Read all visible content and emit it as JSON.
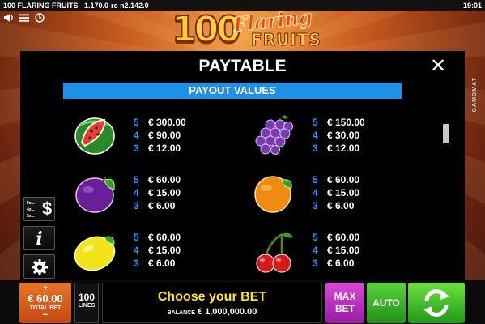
{
  "status_bar": {
    "title": "100 FLARING FRUITS",
    "version": "1.170.0-rc n2.142.0",
    "clock": "19:01"
  },
  "logo": {
    "number": "100",
    "word1": "Flaring",
    "word2": "FRUITS"
  },
  "brand": "GAMOMAT",
  "paytable": {
    "title": "PAYTABLE",
    "close_label": "✕",
    "section_title": "PAYOUT VALUES",
    "symbols": [
      {
        "icon": "watermelon-icon",
        "pays": [
          {
            "count": "5",
            "value": "€ 300.00"
          },
          {
            "count": "4",
            "value": "€ 90.00"
          },
          {
            "count": "3",
            "value": "€ 12.00"
          }
        ]
      },
      {
        "icon": "grapes-icon",
        "pays": [
          {
            "count": "5",
            "value": "€ 150.00"
          },
          {
            "count": "4",
            "value": "€ 30.00"
          },
          {
            "count": "3",
            "value": "€ 12.00"
          }
        ]
      },
      {
        "icon": "plum-icon",
        "pays": [
          {
            "count": "5",
            "value": "€ 60.00"
          },
          {
            "count": "4",
            "value": "€ 15.00"
          },
          {
            "count": "3",
            "value": "€ 6.00"
          }
        ]
      },
      {
        "icon": "orange-icon",
        "pays": [
          {
            "count": "5",
            "value": "€ 60.00"
          },
          {
            "count": "4",
            "value": "€ 15.00"
          },
          {
            "count": "3",
            "value": "€ 6.00"
          }
        ]
      },
      {
        "icon": "lemon-icon",
        "pays": [
          {
            "count": "5",
            "value": "€ 60.00"
          },
          {
            "count": "4",
            "value": "€ 15.00"
          },
          {
            "count": "3",
            "value": "€ 6.00"
          }
        ]
      },
      {
        "icon": "cherries-icon",
        "pays": [
          {
            "count": "5",
            "value": "€ 60.00"
          },
          {
            "count": "4",
            "value": "€ 15.00"
          },
          {
            "count": "3",
            "value": "€ 6.00"
          }
        ]
      }
    ]
  },
  "side_buttons": {
    "paytable_rows": [
      "5x...",
      "4x...",
      "3x..."
    ],
    "paytable_symbol": "$",
    "info_symbol": "i"
  },
  "bottom": {
    "total_bet_plus": "+",
    "total_bet_value": "€ 60.00",
    "total_bet_label": "TOTAL BET",
    "total_bet_minus": "−",
    "lines_value": "100",
    "lines_label": "LINES",
    "choose_text": "Choose your BET",
    "balance_label": "BALANCE",
    "balance_value": "€ 1,000,000.00",
    "max_bet_label_1": "MAX",
    "max_bet_label_2": "BET",
    "auto_label": "AUTO"
  },
  "colors": {
    "accent_blue": "#1e90e6",
    "count_blue": "#3a8cff",
    "choose_yellow": "#ffe628",
    "total_bet_orange": "#d85f1c",
    "max_bet_purple": "#c032c4",
    "auto_green": "#3cb82a"
  }
}
